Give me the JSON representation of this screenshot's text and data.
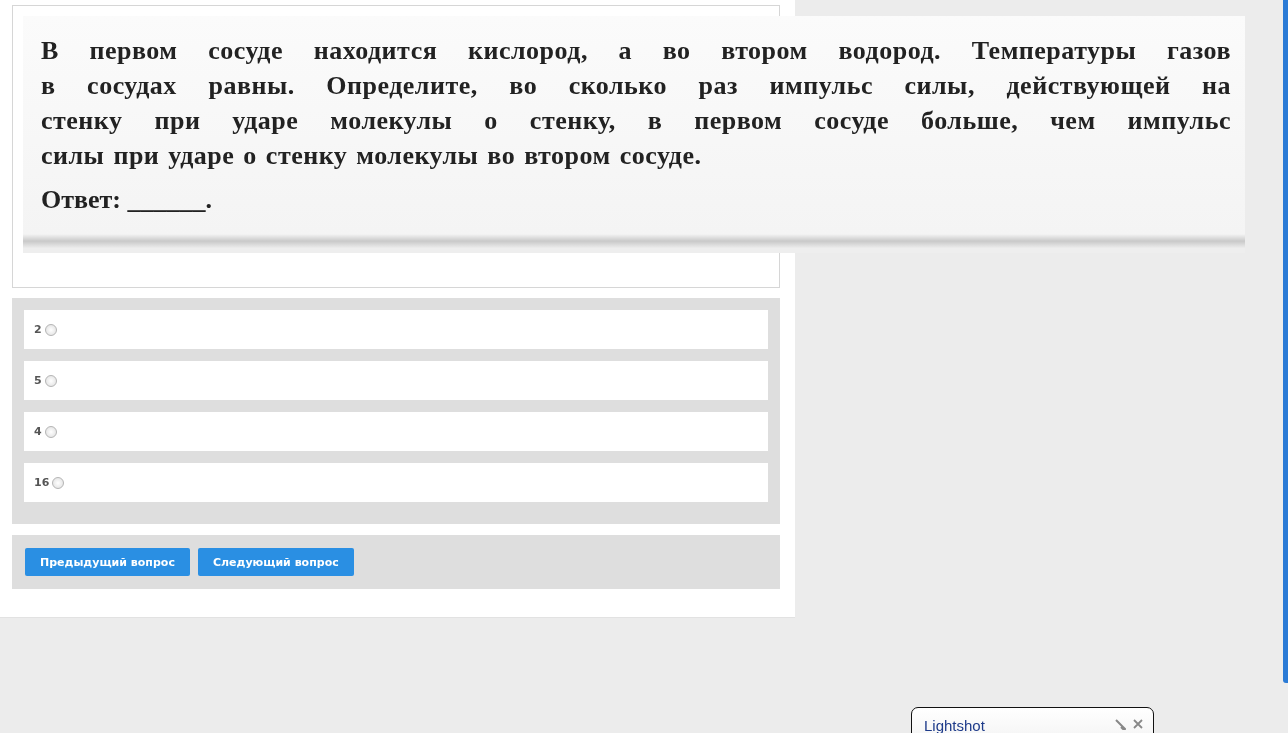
{
  "question": {
    "text": "В первом сосуде находится кислород, а во втором водород. Температуры газов\nв сосудах равны. Определите, во сколько раз импульс силы, действующей на\nстенку при ударе молекулы о стенку, в первом сосуде больше, чем импульс\nсилы при ударе о стенку молекулы во втором сосуде.",
    "answer_label": "Ответ: ______."
  },
  "options": [
    {
      "label": "2",
      "selected": false
    },
    {
      "label": "5",
      "selected": false
    },
    {
      "label": "4",
      "selected": false
    },
    {
      "label": "16",
      "selected": false
    }
  ],
  "buttons": [
    "Предыдущий вопрос",
    "Следующий вопрос"
  ],
  "popup": {
    "title": "Lightshot"
  }
}
